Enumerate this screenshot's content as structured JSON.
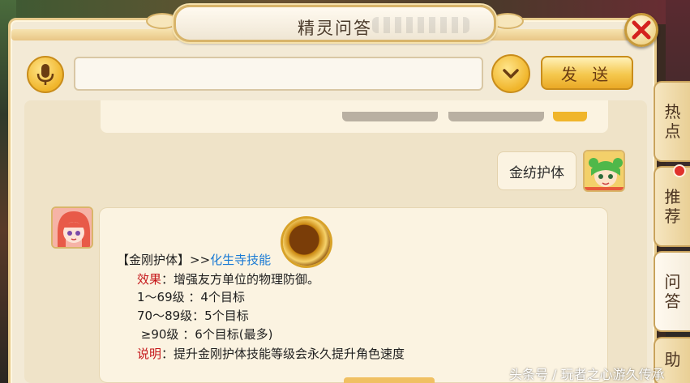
{
  "window": {
    "title": "精灵问答",
    "close_label": "close"
  },
  "input": {
    "value": "",
    "placeholder": "",
    "send_label": "发 送"
  },
  "side_tabs": [
    {
      "label": "热\n点"
    },
    {
      "label": "推\n荐"
    },
    {
      "label": "问\n答"
    },
    {
      "label": "助"
    }
  ],
  "chat": {
    "user_message": "金纺护体",
    "answer": {
      "title": "【金刚护体】>>",
      "title_link": "化生寺技能",
      "effect_label": "效果",
      "effect_text": "：增强友方单位的物理防御。",
      "tier1": "1～69级 ：4个目标",
      "tier2": "70～89级：5个目标",
      "tier3": " ≥90级 ：6个目标(最多)",
      "note_label": "说明",
      "note_text": "：提升金刚护体技能等级会永久提升角色速度"
    }
  },
  "watermark": "头条号 / 玩者之心游久传承",
  "colors": {
    "frame_bg": "#f3ead6",
    "gold": "#f0b52b",
    "red_text": "#c5171a",
    "link_blue": "#1a7ad4",
    "close_red": "#d4221f"
  },
  "icons": {
    "close": "close-x-icon",
    "mic": "microphone-icon",
    "dropdown": "chevron-down-icon",
    "skill": "skill-icon"
  }
}
